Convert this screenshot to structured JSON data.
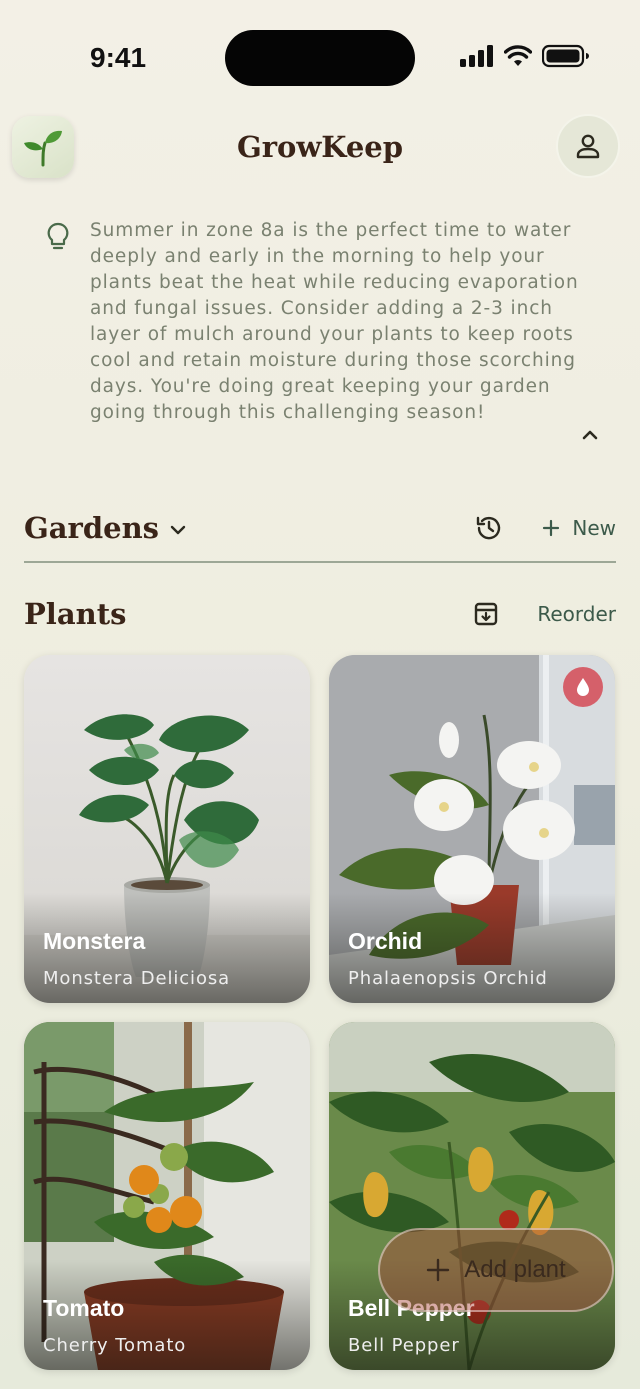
{
  "status_bar": {
    "time": "9:41"
  },
  "header": {
    "title": "GrowKeep",
    "logo_icon": "seedling-icon",
    "profile_icon": "person-icon"
  },
  "tip": {
    "icon": "lightbulb-icon",
    "text": "Summer in zone 8a is the perfect time to water deeply and early in the morning to help your plants beat the heat while reducing evaporation and fungal issues. Consider adding a 2-3 inch layer of mulch around your plants to keep roots cool and retain moisture during those scorching days. You're doing great keeping your garden going through this challenging season!",
    "collapse_icon": "chevron-up-icon"
  },
  "gardens": {
    "title": "Gardens",
    "history_icon": "history-icon",
    "new_label": "New"
  },
  "plants": {
    "title": "Plants",
    "archive_icon": "archive-icon",
    "reorder_label": "Reorder",
    "items": [
      {
        "name": "Monstera",
        "scientific": "Monstera Deliciosa",
        "needs_water": false
      },
      {
        "name": "Orchid",
        "scientific": "Phalaenopsis Orchid",
        "needs_water": true
      },
      {
        "name": "Tomato",
        "scientific": "Cherry Tomato",
        "needs_water": false
      },
      {
        "name": "Bell Pepper",
        "scientific": "Bell Pepper",
        "needs_water": false
      }
    ]
  },
  "fab": {
    "label": "Add plant",
    "icon": "plus-icon"
  },
  "colors": {
    "accent": "#3c5a4a",
    "title": "#3a2418",
    "water_badge": "#d5606a",
    "tip_text": "#7a8170"
  }
}
